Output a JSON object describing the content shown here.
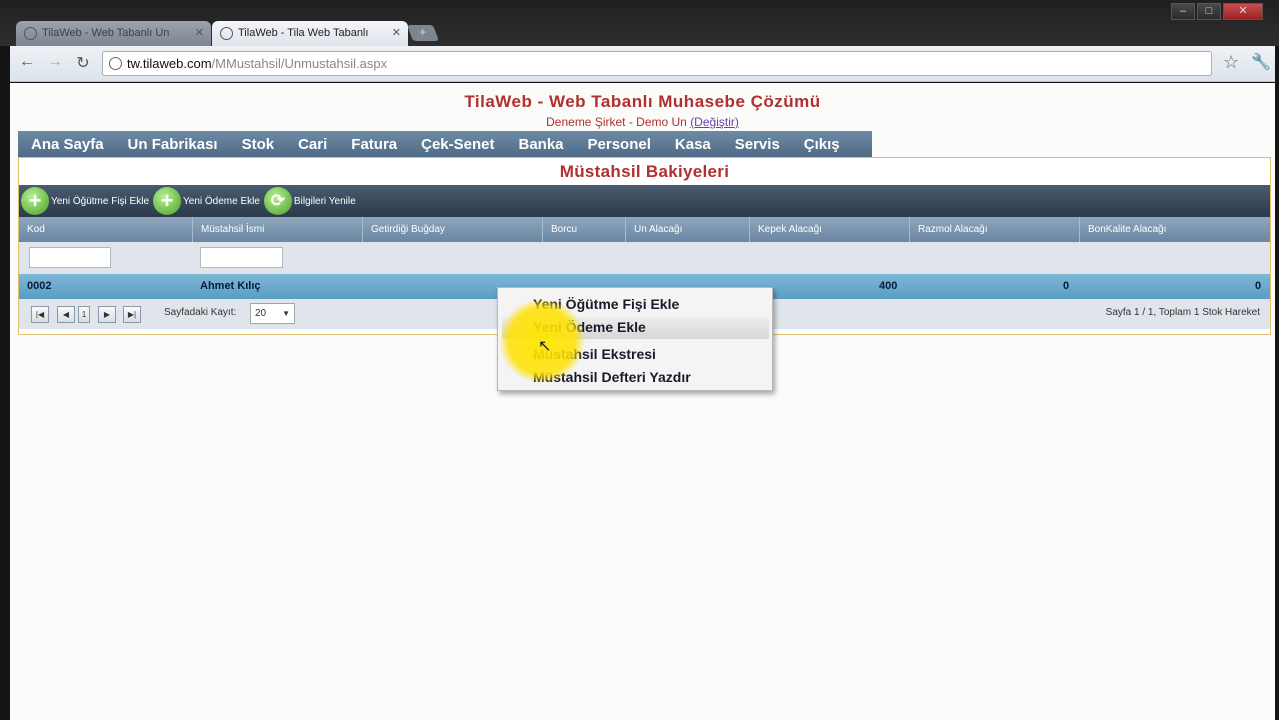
{
  "browser": {
    "tabs": [
      {
        "title": "TilaWeb - Web Tabanlı Un",
        "active": false
      },
      {
        "title": "TilaWeb - Tila Web Tabanlı",
        "active": true
      }
    ],
    "url_host": "tw.tilaweb.com",
    "url_path": "/MMustahsil/Unmustahsil.aspx"
  },
  "header": {
    "title": "TilaWeb - Web Tabanlı Muhasebe Çözümü",
    "subtitle": "Deneme Şirket - Demo Un",
    "change_link": "(Değiştir)"
  },
  "menu": [
    "Ana Sayfa",
    "Un Fabrikası",
    "Stok",
    "Cari",
    "Fatura",
    "Çek-Senet",
    "Banka",
    "Personel",
    "Kasa",
    "Servis",
    "Çıkış"
  ],
  "panel": {
    "title": "Müstahsil Bakiyeleri",
    "actions": [
      "Yeni Öğütme Fişi Ekle",
      "Yeni Ödeme Ekle",
      "Bilgileri Yenile"
    ],
    "columns": [
      "Kod",
      "Müstahsil İsmi",
      "Getirdiği Buğday",
      "Borcu",
      "Un Alacağı",
      "Kepek Alacağı",
      "Razmol Alacağı",
      "BonKalite Alacağı"
    ],
    "row": {
      "kod": "0002",
      "isim": "Ahmet Kılıç",
      "kepek": "400",
      "razmol": "0",
      "bonkalite": "0"
    },
    "pager": {
      "page": "1",
      "per_page_label": "Sayfadaki Kayıt:",
      "per_page": "20",
      "info": "Sayfa 1 / 1, Toplam 1 Stok Hareket"
    }
  },
  "context_menu": {
    "items": [
      "Yeni Öğütme Fişi Ekle",
      "Yeni Ödeme Ekle",
      "Müstahsil Ekstresi",
      "Müstahsil Defteri Yazdır"
    ],
    "highlighted_index": 1
  },
  "colors": {
    "accent": "#b03030",
    "menu_bg": "#5a7692",
    "row_bg": "#6aa8cc"
  }
}
